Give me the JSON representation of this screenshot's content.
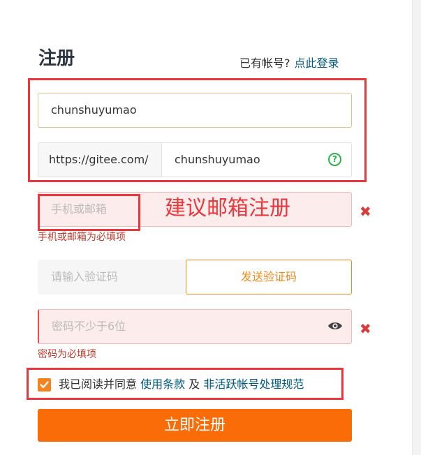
{
  "form": {
    "title": "注册",
    "have_account": "已有帐号?",
    "login_link": "点此登录",
    "username": {
      "value": "chunshuyumao"
    },
    "space_url": {
      "prefix": "https://gitee.com/",
      "value": "chunshuyumao"
    },
    "account": {
      "placeholder": "手机或邮箱",
      "error": "手机或邮箱为必填项"
    },
    "code": {
      "placeholder": "请输入验证码",
      "send_label": "发送验证码"
    },
    "password": {
      "placeholder": "密码不少于6位",
      "error": "密码为必填项"
    },
    "agreement": {
      "checked": true,
      "text": "我已阅读并同意",
      "terms_link": "使用条款",
      "conj": "及",
      "policy_link": "非活跃帐号处理规范"
    },
    "submit_label": "立即注册"
  },
  "annotation": {
    "note": "建议邮箱注册",
    "color": "#e8373d"
  },
  "colors": {
    "accent": "#fa6c08",
    "link": "#005980",
    "error": "#db3b3b"
  },
  "icons": {
    "help": "question-circle-icon",
    "eye": "eye-icon",
    "error": "x-icon",
    "check": "check-icon"
  }
}
